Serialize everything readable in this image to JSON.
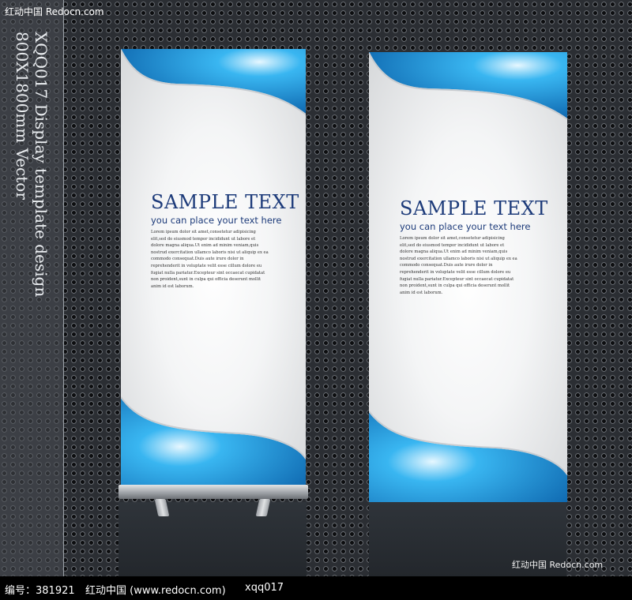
{
  "watermark_top": "红动中国 Redocn.com",
  "watermark_bottom": "红动中国 Redocn.com",
  "side_text": {
    "line1": "XQQ017 Display template design",
    "line2": "800X1800mm Vector"
  },
  "banners": [
    {
      "title": "SAMPLE TEXT",
      "subtitle": "you can place your text here",
      "body": "Lorem ipsum dolor sit amet,consetetur adipisicing elit,sed do eiusmod tempor incididunt ut labore et dolore magna aliqua.Ut enim ad minim veniam,quis nostrud exercitation ullamco laboris nisi ut aliquip ex ea commodo consequat.Duis aute irure dolor in reprehenderit in voluptate velit esse cillum dolore eu fugiat nulla pariatur.Excepteur sint occaecat cupidatat non proident,sunt in culpa qui officia deserunt mollit anim id est laborum."
    },
    {
      "title": "SAMPLE TEXT",
      "subtitle": "you can place your text here",
      "body": "Lorem ipsum dolor sit amet,consetetur adipisicing elit,sed do eiusmod tempor incididunt ut labore et dolore magna aliqua.Ut enim ad minim veniam,quis nostrud exercitation ullamco laboris nisi ut aliquip ex ea commodo consequat.Duis aute irure dolor in reprehenderit in voluptate velit esse cillum dolore eu fugiat nulla pariatur.Excepteur sint occaecat cupidatat non proident,sunt in culpa qui officia deserunt mollit anim id est laborum."
    }
  ],
  "footer": {
    "id": "编号：381921",
    "site": "红动中国 (www.redocn.com)",
    "code": "xqq017"
  },
  "colors": {
    "accent_blue": "#1a9ae0",
    "title_blue": "#1d3b7a"
  }
}
